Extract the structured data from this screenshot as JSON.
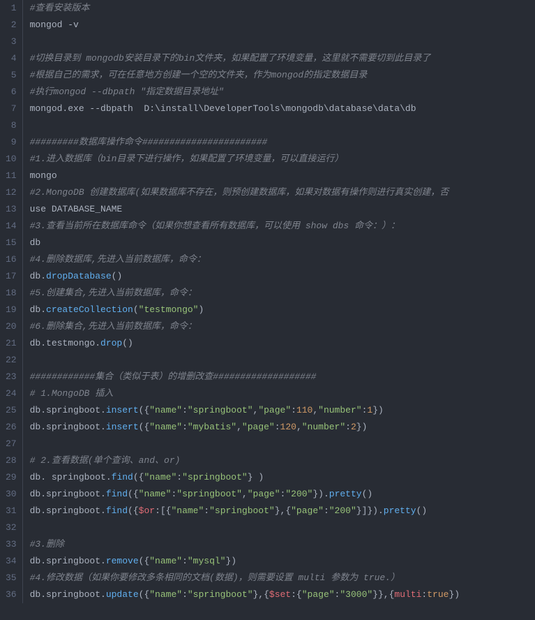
{
  "lines": [
    {
      "n": "1",
      "seg": [
        {
          "c": "comment",
          "t": "#查看安装版本"
        }
      ]
    },
    {
      "n": "2",
      "seg": [
        {
          "c": "plain",
          "t": "mongod -v"
        }
      ]
    },
    {
      "n": "3",
      "seg": []
    },
    {
      "n": "4",
      "seg": [
        {
          "c": "comment",
          "t": "#切换目录到 mongodb安装目录下的bin文件夹，如果配置了环境变量，这里就不需要切到此目录了"
        }
      ]
    },
    {
      "n": "5",
      "seg": [
        {
          "c": "comment",
          "t": "#根据自己的需求，可在任意地方创建一个空的文件夹，作为mongod的指定数据目录"
        }
      ]
    },
    {
      "n": "6",
      "seg": [
        {
          "c": "comment",
          "t": "#执行mongod --dbpath \"指定数据目录地址\""
        }
      ]
    },
    {
      "n": "7",
      "seg": [
        {
          "c": "plain",
          "t": "mongod.exe --dbpath  D:\\install\\DeveloperTools\\mongodb\\database\\data\\db"
        }
      ]
    },
    {
      "n": "8",
      "seg": []
    },
    {
      "n": "9",
      "seg": [
        {
          "c": "comment",
          "t": "#########数据库操作命令#######################"
        }
      ]
    },
    {
      "n": "10",
      "seg": [
        {
          "c": "comment",
          "t": "#1.进入数据库（bin目录下进行操作，如果配置了环境变量，可以直接运行）"
        }
      ]
    },
    {
      "n": "11",
      "seg": [
        {
          "c": "plain",
          "t": "mongo"
        }
      ]
    },
    {
      "n": "12",
      "seg": [
        {
          "c": "comment",
          "t": "#2.MongoDB 创建数据库(如果数据库不存在，则预创建数据库，如果对数据有操作则进行真实创建，否"
        }
      ]
    },
    {
      "n": "13",
      "seg": [
        {
          "c": "plain",
          "t": "use DATABASE_NAME"
        }
      ]
    },
    {
      "n": "14",
      "seg": [
        {
          "c": "comment",
          "t": "#3.查看当前所在数据库命令（如果你想查看所有数据库，可以使用 show dbs 命令：）："
        }
      ]
    },
    {
      "n": "15",
      "seg": [
        {
          "c": "plain",
          "t": "db"
        }
      ]
    },
    {
      "n": "16",
      "seg": [
        {
          "c": "comment",
          "t": "#4.删除数据库,先进入当前数据库，命令："
        }
      ]
    },
    {
      "n": "17",
      "seg": [
        {
          "c": "plain",
          "t": "db."
        },
        {
          "c": "func",
          "t": "dropDatabase"
        },
        {
          "c": "plain",
          "t": "()"
        }
      ]
    },
    {
      "n": "18",
      "seg": [
        {
          "c": "comment",
          "t": "#5.创建集合,先进入当前数据库，命令："
        }
      ]
    },
    {
      "n": "19",
      "seg": [
        {
          "c": "plain",
          "t": "db."
        },
        {
          "c": "func",
          "t": "createCollection"
        },
        {
          "c": "plain",
          "t": "("
        },
        {
          "c": "string",
          "t": "\"testmongo\""
        },
        {
          "c": "plain",
          "t": ")"
        }
      ]
    },
    {
      "n": "20",
      "seg": [
        {
          "c": "comment",
          "t": "#6.删除集合,先进入当前数据库，命令："
        }
      ]
    },
    {
      "n": "21",
      "seg": [
        {
          "c": "plain",
          "t": "db.testmongo."
        },
        {
          "c": "func",
          "t": "drop"
        },
        {
          "c": "plain",
          "t": "()"
        }
      ]
    },
    {
      "n": "22",
      "seg": []
    },
    {
      "n": "23",
      "seg": [
        {
          "c": "comment",
          "t": "############集合（类似于表）的增删改查###################"
        }
      ]
    },
    {
      "n": "24",
      "seg": [
        {
          "c": "comment",
          "t": "# 1.MongoDB 插入"
        }
      ]
    },
    {
      "n": "25",
      "seg": [
        {
          "c": "plain",
          "t": "db.springboot."
        },
        {
          "c": "func",
          "t": "insert"
        },
        {
          "c": "plain",
          "t": "({"
        },
        {
          "c": "string",
          "t": "\"name\""
        },
        {
          "c": "plain",
          "t": ":"
        },
        {
          "c": "string",
          "t": "\"springboot\""
        },
        {
          "c": "plain",
          "t": ","
        },
        {
          "c": "string",
          "t": "\"page\""
        },
        {
          "c": "plain",
          "t": ":"
        },
        {
          "c": "number",
          "t": "110"
        },
        {
          "c": "plain",
          "t": ","
        },
        {
          "c": "string",
          "t": "\"number\""
        },
        {
          "c": "plain",
          "t": ":"
        },
        {
          "c": "number",
          "t": "1"
        },
        {
          "c": "plain",
          "t": "})"
        }
      ]
    },
    {
      "n": "26",
      "seg": [
        {
          "c": "plain",
          "t": "db.springboot."
        },
        {
          "c": "func",
          "t": "insert"
        },
        {
          "c": "plain",
          "t": "({"
        },
        {
          "c": "string",
          "t": "\"name\""
        },
        {
          "c": "plain",
          "t": ":"
        },
        {
          "c": "string",
          "t": "\"mybatis\""
        },
        {
          "c": "plain",
          "t": ","
        },
        {
          "c": "string",
          "t": "\"page\""
        },
        {
          "c": "plain",
          "t": ":"
        },
        {
          "c": "number",
          "t": "120"
        },
        {
          "c": "plain",
          "t": ","
        },
        {
          "c": "string",
          "t": "\"number\""
        },
        {
          "c": "plain",
          "t": ":"
        },
        {
          "c": "number",
          "t": "2"
        },
        {
          "c": "plain",
          "t": "})"
        }
      ]
    },
    {
      "n": "27",
      "seg": []
    },
    {
      "n": "28",
      "seg": [
        {
          "c": "comment",
          "t": "# 2.查看数据(单个查询、and、or)"
        }
      ]
    },
    {
      "n": "29",
      "seg": [
        {
          "c": "plain",
          "t": "db. springboot."
        },
        {
          "c": "func",
          "t": "find"
        },
        {
          "c": "plain",
          "t": "({"
        },
        {
          "c": "string",
          "t": "\"name\""
        },
        {
          "c": "plain",
          "t": ":"
        },
        {
          "c": "string",
          "t": "\"springboot\""
        },
        {
          "c": "plain",
          "t": "} )"
        }
      ]
    },
    {
      "n": "30",
      "seg": [
        {
          "c": "plain",
          "t": "db.springboot."
        },
        {
          "c": "func",
          "t": "find"
        },
        {
          "c": "plain",
          "t": "({"
        },
        {
          "c": "string",
          "t": "\"name\""
        },
        {
          "c": "plain",
          "t": ":"
        },
        {
          "c": "string",
          "t": "\"springboot\""
        },
        {
          "c": "plain",
          "t": ","
        },
        {
          "c": "string",
          "t": "\"page\""
        },
        {
          "c": "plain",
          "t": ":"
        },
        {
          "c": "string",
          "t": "\"200\""
        },
        {
          "c": "plain",
          "t": "})."
        },
        {
          "c": "func",
          "t": "pretty"
        },
        {
          "c": "plain",
          "t": "()"
        }
      ]
    },
    {
      "n": "31",
      "seg": [
        {
          "c": "plain",
          "t": "db.springboot."
        },
        {
          "c": "func",
          "t": "find"
        },
        {
          "c": "plain",
          "t": "({"
        },
        {
          "c": "prop",
          "t": "$or"
        },
        {
          "c": "plain",
          "t": ":[{"
        },
        {
          "c": "string",
          "t": "\"name\""
        },
        {
          "c": "plain",
          "t": ":"
        },
        {
          "c": "string",
          "t": "\"springboot\""
        },
        {
          "c": "plain",
          "t": "},{"
        },
        {
          "c": "string",
          "t": "\"page\""
        },
        {
          "c": "plain",
          "t": ":"
        },
        {
          "c": "string",
          "t": "\"200\""
        },
        {
          "c": "plain",
          "t": "}]})."
        },
        {
          "c": "func",
          "t": "pretty"
        },
        {
          "c": "plain",
          "t": "()"
        }
      ]
    },
    {
      "n": "32",
      "seg": []
    },
    {
      "n": "33",
      "seg": [
        {
          "c": "comment",
          "t": "#3.删除"
        }
      ]
    },
    {
      "n": "34",
      "seg": [
        {
          "c": "plain",
          "t": "db.springboot."
        },
        {
          "c": "func",
          "t": "remove"
        },
        {
          "c": "plain",
          "t": "({"
        },
        {
          "c": "string",
          "t": "\"name\""
        },
        {
          "c": "plain",
          "t": ":"
        },
        {
          "c": "string",
          "t": "\"mysql\""
        },
        {
          "c": "plain",
          "t": "})"
        }
      ]
    },
    {
      "n": "35",
      "seg": [
        {
          "c": "comment",
          "t": "#4.修改数据（如果你要修改多条相同的文档(数据)，则需要设置 multi 参数为 true.）"
        }
      ]
    },
    {
      "n": "36",
      "seg": [
        {
          "c": "plain",
          "t": "db.springboot."
        },
        {
          "c": "func",
          "t": "update"
        },
        {
          "c": "plain",
          "t": "({"
        },
        {
          "c": "string",
          "t": "\"name\""
        },
        {
          "c": "plain",
          "t": ":"
        },
        {
          "c": "string",
          "t": "\"springboot\""
        },
        {
          "c": "plain",
          "t": "},{"
        },
        {
          "c": "prop",
          "t": "$set"
        },
        {
          "c": "plain",
          "t": ":{"
        },
        {
          "c": "string",
          "t": "\"page\""
        },
        {
          "c": "plain",
          "t": ":"
        },
        {
          "c": "string",
          "t": "\"3000\""
        },
        {
          "c": "plain",
          "t": "}},{"
        },
        {
          "c": "prop",
          "t": "multi"
        },
        {
          "c": "plain",
          "t": ":"
        },
        {
          "c": "bool",
          "t": "true"
        },
        {
          "c": "plain",
          "t": "})"
        }
      ]
    }
  ]
}
